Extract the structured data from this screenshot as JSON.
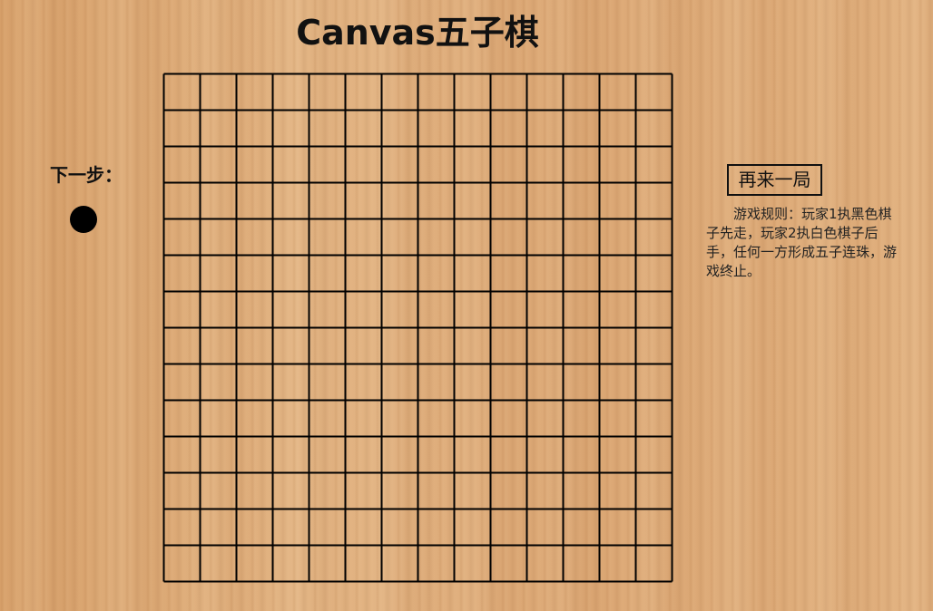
{
  "title": "Canvas五子棋",
  "next_move": {
    "label": "下一步：",
    "stone_color": "#000000"
  },
  "board": {
    "rows": 14,
    "cols": 14,
    "line_color": "#000000"
  },
  "restart_button": {
    "label": "再来一局"
  },
  "rules": {
    "text": "游戏规则：玩家1执黑色棋子先走，玩家2执白色棋子后手，任何一方形成五子连珠，游戏终止。"
  }
}
